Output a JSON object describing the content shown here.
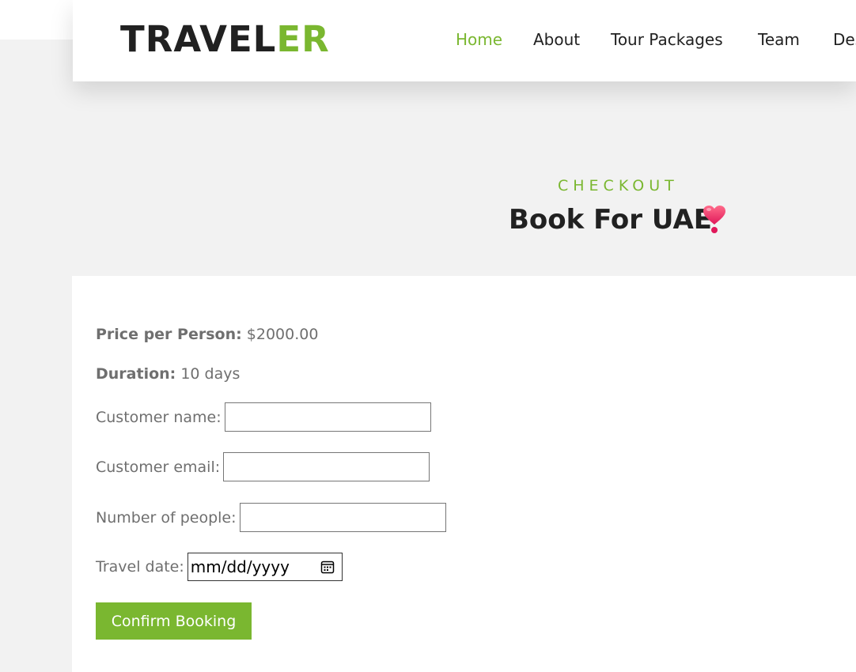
{
  "brand": {
    "part1": "TRAVEL",
    "part2": "ER"
  },
  "nav": {
    "items": [
      {
        "label": "Home",
        "active": true
      },
      {
        "label": "About",
        "active": false
      },
      {
        "label": "Tour Packages",
        "active": false
      },
      {
        "label": "Team",
        "active": false
      },
      {
        "label": "Des",
        "active": false
      }
    ]
  },
  "header": {
    "subtitle": "CHECKOUT",
    "title": "Book For UAE",
    "icon": "heart-emoji-icon"
  },
  "booking": {
    "price_label": "Price per Person:",
    "price_value": "$2000.00",
    "duration_label": "Duration:",
    "duration_value": "10 days",
    "customer_name_label": "Customer name:",
    "customer_email_label": "Customer email:",
    "people_label": "Number of people:",
    "travel_date_label": "Travel date:",
    "travel_date_placeholder": "mm/dd/yyyy",
    "confirm_label": "Confirm Booking"
  },
  "colors": {
    "accent": "#7ab730",
    "dark": "#212121",
    "muted": "#6f6f6f"
  }
}
